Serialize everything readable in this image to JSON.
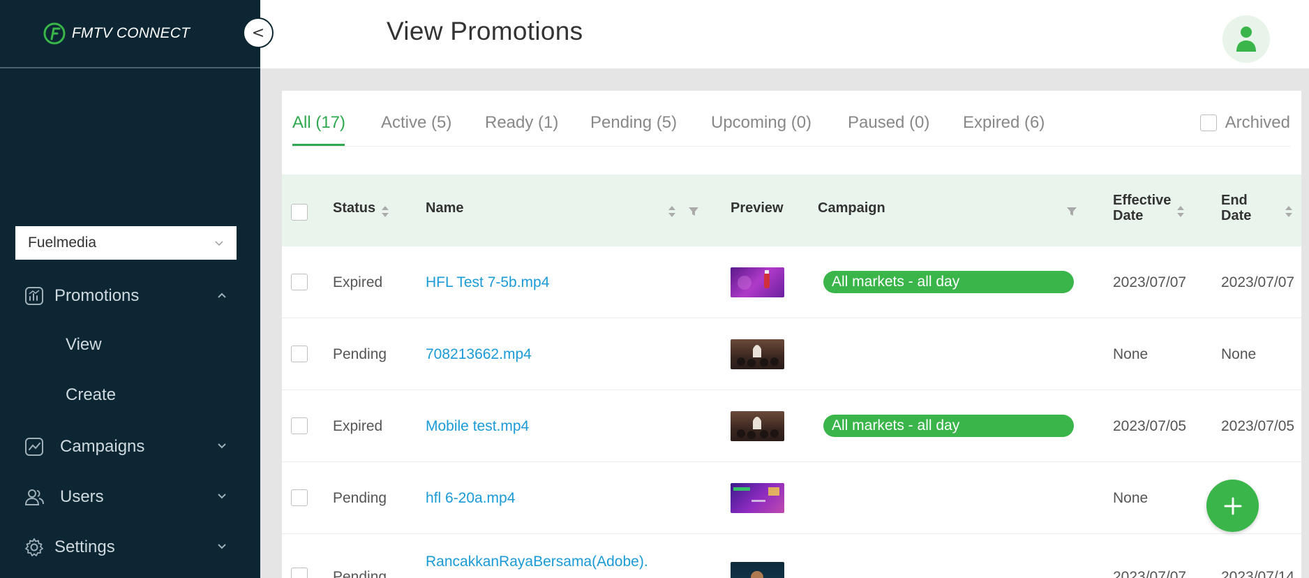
{
  "sidebar": {
    "brand_name": "FMTV CONNECT",
    "collapse_label": "<",
    "org_selector": {
      "value": "Fuelmedia"
    },
    "nav": [
      {
        "label": "Promotions",
        "icon": "chart-icon",
        "expanded": true
      },
      {
        "label": "Campaigns",
        "icon": "trend-icon",
        "expanded": false
      },
      {
        "label": "Users",
        "icon": "users-icon",
        "expanded": false
      },
      {
        "label": "Settings",
        "icon": "gear-icon",
        "expanded": false
      }
    ],
    "promotions_sub": [
      {
        "label": "View"
      },
      {
        "label": "Create"
      }
    ]
  },
  "header": {
    "title": "View Promotions",
    "avatar_icon": "user-icon"
  },
  "tabs": [
    {
      "label": "All (17)",
      "active": true
    },
    {
      "label": "Active (5)",
      "active": false
    },
    {
      "label": "Ready (1)",
      "active": false
    },
    {
      "label": "Pending (5)",
      "active": false
    },
    {
      "label": "Upcoming (0)",
      "active": false
    },
    {
      "label": "Paused (0)",
      "active": false
    },
    {
      "label": "Expired (6)",
      "active": false
    }
  ],
  "archived_label": "Archived",
  "table": {
    "columns": {
      "status": "Status",
      "name": "Name",
      "preview": "Preview",
      "campaign": "Campaign",
      "effective_date_1": "Effective",
      "effective_date_2": "Date",
      "end_date_1": "End",
      "end_date_2": "Date"
    },
    "rows": [
      {
        "status": "Expired",
        "name": "HFL Test 7-5b.mp4",
        "campaign": "All markets - all day",
        "effective": "2023/07/07",
        "end": "2023/07/07"
      },
      {
        "status": "Pending",
        "name": "708213662.mp4",
        "campaign": "",
        "effective": "None",
        "end": "None"
      },
      {
        "status": "Expired",
        "name": "Mobile test.mp4",
        "campaign": "All markets - all day",
        "effective": "2023/07/05",
        "end": "2023/07/05"
      },
      {
        "status": "Pending",
        "name": "hfl 6-20a.mp4",
        "campaign": "",
        "effective": "None",
        "end": ""
      },
      {
        "status": "Pending",
        "name": "RancakkanRayaBersama(Adobe).",
        "campaign": "",
        "effective": "2023/07/07",
        "end": "2023/07/14"
      }
    ]
  },
  "fab_label": "+",
  "colors": {
    "sidebar_bg": "#0c2733",
    "accent_green": "#39b54a",
    "link_blue": "#1a9ad6",
    "header_row_bg": "#e9f5ec"
  }
}
